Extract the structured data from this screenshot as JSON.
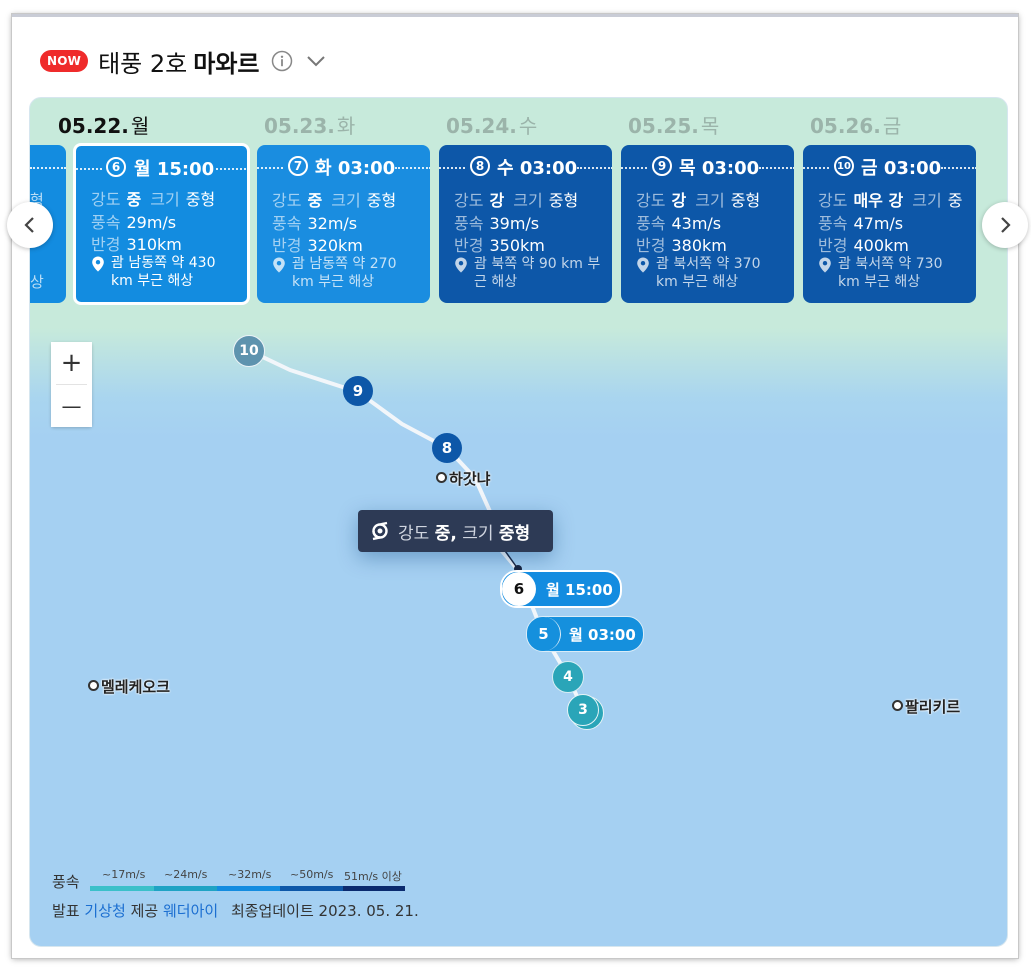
{
  "header": {
    "badge": "NOW",
    "title_prefix": "태풍 2호",
    "title_name": "마와르"
  },
  "dates": [
    {
      "date": "05.22.",
      "weekday": "월",
      "active": true
    },
    {
      "date": "05.23.",
      "weekday": "화",
      "active": false
    },
    {
      "date": "05.24.",
      "weekday": "수",
      "active": false
    },
    {
      "date": "05.25.",
      "weekday": "목",
      "active": false
    },
    {
      "date": "05.26.",
      "weekday": "금",
      "active": false
    }
  ],
  "partial_card": {
    "frag1": "형",
    "frag2": "상"
  },
  "labels": {
    "strength": "강도",
    "size": "크기",
    "wind": "풍속",
    "radius": "반경"
  },
  "cards": [
    {
      "num": "6",
      "time": "월 15:00",
      "strength": "중",
      "size": "중형",
      "wind": "29m/s",
      "radius": "310km",
      "location": "괌 남동쪽 약 430 km 부근 해상"
    },
    {
      "num": "7",
      "time": "화 03:00",
      "strength": "중",
      "size": "중형",
      "wind": "32m/s",
      "radius": "320km",
      "location": "괌 남동쪽 약 270 km 부근 해상"
    },
    {
      "num": "8",
      "time": "수 03:00",
      "strength": "강",
      "size": "중형",
      "wind": "39m/s",
      "radius": "350km",
      "location": "괌 북쪽 약 90 km 부근 해상"
    },
    {
      "num": "9",
      "time": "목 03:00",
      "strength": "강",
      "size": "중형",
      "wind": "43m/s",
      "radius": "380km",
      "location": "괌 북서쪽 약 370 km 부근 해상"
    },
    {
      "num": "10",
      "time": "금 03:00",
      "strength": "매우 강",
      "size": "중",
      "wind": "47m/s",
      "radius": "400km",
      "location": "괌 북서쪽 약 730 km 부근 해상"
    }
  ],
  "map": {
    "markers": [
      "10",
      "9",
      "8",
      "4",
      "3"
    ],
    "places": [
      "하갓냐",
      "멜레케오크",
      "팔리키르"
    ],
    "tooltip": {
      "k1": "강도",
      "v1": "중,",
      "k2": "크기",
      "v2": "중형"
    },
    "pills": [
      {
        "num": "6",
        "label": "월 15:00"
      },
      {
        "num": "5",
        "label": "월 03:00"
      }
    ],
    "zoom_in": "+",
    "zoom_out": "—"
  },
  "legend": {
    "label": "풍속",
    "steps": [
      "~17m/s",
      "~24m/s",
      "~32m/s",
      "~50m/s",
      "51m/s 이상"
    ],
    "colors": [
      "#3bc0c9",
      "#1fa3c4",
      "#138ce0",
      "#0d57a8",
      "#0b2a6e"
    ]
  },
  "source": {
    "prefix": "발표",
    "agency": "기상청",
    "provided": "제공",
    "provider": "웨더아이",
    "updated": "최종업데이트 2023. 05. 21."
  },
  "colors": {
    "badge": "#ef2b2b",
    "card_active": "#138ce0",
    "card_dark": "#0d57a8",
    "tooltip_bg": "#2d3a55",
    "link": "#1c6fd1"
  }
}
